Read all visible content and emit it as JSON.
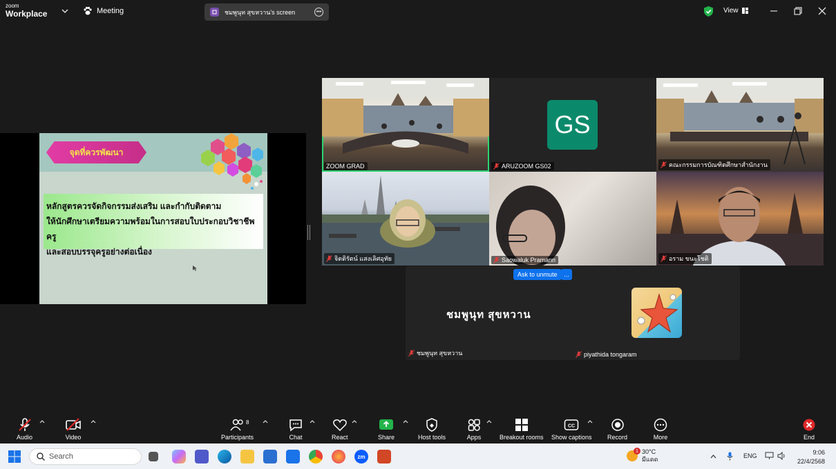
{
  "titlebar": {
    "logo_line1": "zoom",
    "logo_line2": "Workplace",
    "meeting_label": "Meeting",
    "screen_pill": "ชมพูนุท สุขหวาน's screen",
    "view_label": "View"
  },
  "shared_screen": {
    "banner": "จุดที่ควรพัฒนา",
    "lines": [
      "หลักสูตรควรจัดกิจกรรมส่งเสริม และกำกับติดตาม",
      "ให้นักศึกษาเตรียมความพร้อมในการสอบใบประกอบวิชาชีพครู",
      "และสอบบรรจุครูอย่างต่อเนื่อง"
    ]
  },
  "participants_grid": [
    {
      "name": "ZOOM GRAD",
      "muted": false,
      "active": true
    },
    {
      "name": "ARUZOOM GS02",
      "muted": true,
      "initials": "GS"
    },
    {
      "name": "คณะกรรมการบัณฑิตศึกษาสำนักงาน",
      "muted": true
    },
    {
      "name": "จิตติรัตน์ แสงเลิศอุทัย",
      "muted": true
    },
    {
      "name": "Saowaluk Pramann",
      "muted": true
    },
    {
      "name": "อราม ขนะโชติ",
      "muted": true
    }
  ],
  "bottom_row": {
    "left_big_name": "ชมพูนุท สุขหวาน",
    "left_name": "ชมพูนุท สุขหวาน",
    "right_name": "piyathida tongaram",
    "ask_to_unmute": "Ask to unmute",
    "more": "..."
  },
  "toolbar": {
    "audio": "Audio",
    "video": "Video",
    "participants": "Participants",
    "participants_count": "8",
    "chat": "Chat",
    "react": "React",
    "share": "Share",
    "host_tools": "Host tools",
    "apps": "Apps",
    "breakout_rooms": "Breakout rooms",
    "show_captions": "Show captions",
    "record": "Record",
    "more": "More",
    "end": "End"
  },
  "taskbar": {
    "search_placeholder": "Search",
    "temperature": "30°C",
    "weather_desc": "มีแดด",
    "weather_badge": "1",
    "lang": "ENG",
    "time": "9:06",
    "date": "22/4/2568"
  },
  "colors": {
    "accent_blue": "#0e72ed",
    "active_green": "#2ed573",
    "end_red": "#e02828",
    "gs_tile": "#0b8a6b"
  }
}
